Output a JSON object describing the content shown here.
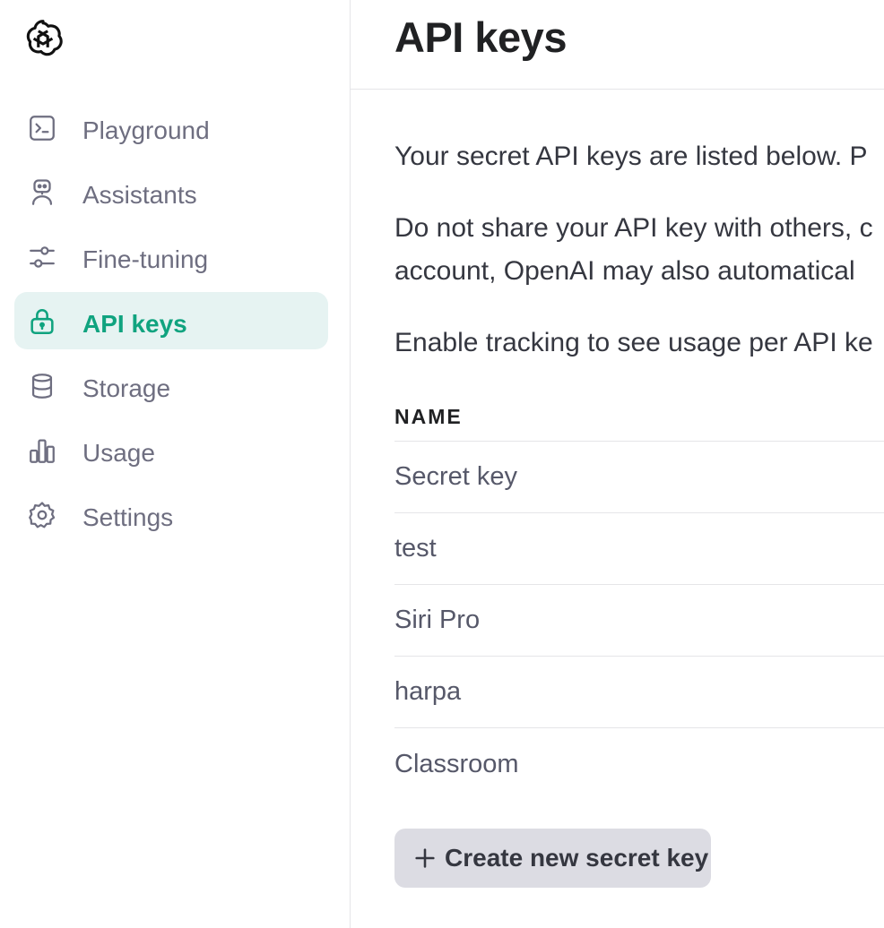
{
  "sidebar": {
    "logo_icon": "openai-logo-icon",
    "items": [
      {
        "label": "Playground",
        "icon": "terminal-icon",
        "active": false
      },
      {
        "label": "Assistants",
        "icon": "robot-icon",
        "active": false
      },
      {
        "label": "Fine-tuning",
        "icon": "sliders-icon",
        "active": false
      },
      {
        "label": "API keys",
        "icon": "lock-icon",
        "active": true
      },
      {
        "label": "Storage",
        "icon": "database-icon",
        "active": false
      },
      {
        "label": "Usage",
        "icon": "bar-chart-icon",
        "active": false
      },
      {
        "label": "Settings",
        "icon": "gear-icon",
        "active": false
      }
    ]
  },
  "header": {
    "title": "API keys"
  },
  "main": {
    "intro": "Your secret API keys are listed below. P",
    "warning_line1": "Do not share your API key with others, c",
    "warning_line2": "account, OpenAI may also automatical",
    "tracking": "Enable tracking to see usage per API ke",
    "table": {
      "column_name": "NAME",
      "rows": [
        {
          "name": "Secret key"
        },
        {
          "name": "test"
        },
        {
          "name": "Siri Pro"
        },
        {
          "name": "harpa"
        },
        {
          "name": "Classroom"
        }
      ]
    },
    "create_button": "Create new secret key"
  },
  "colors": {
    "accent": "#10a37f",
    "active_bg": "#e6f3f2",
    "button_bg": "#dcdce3",
    "muted_text": "#6e6e80"
  }
}
